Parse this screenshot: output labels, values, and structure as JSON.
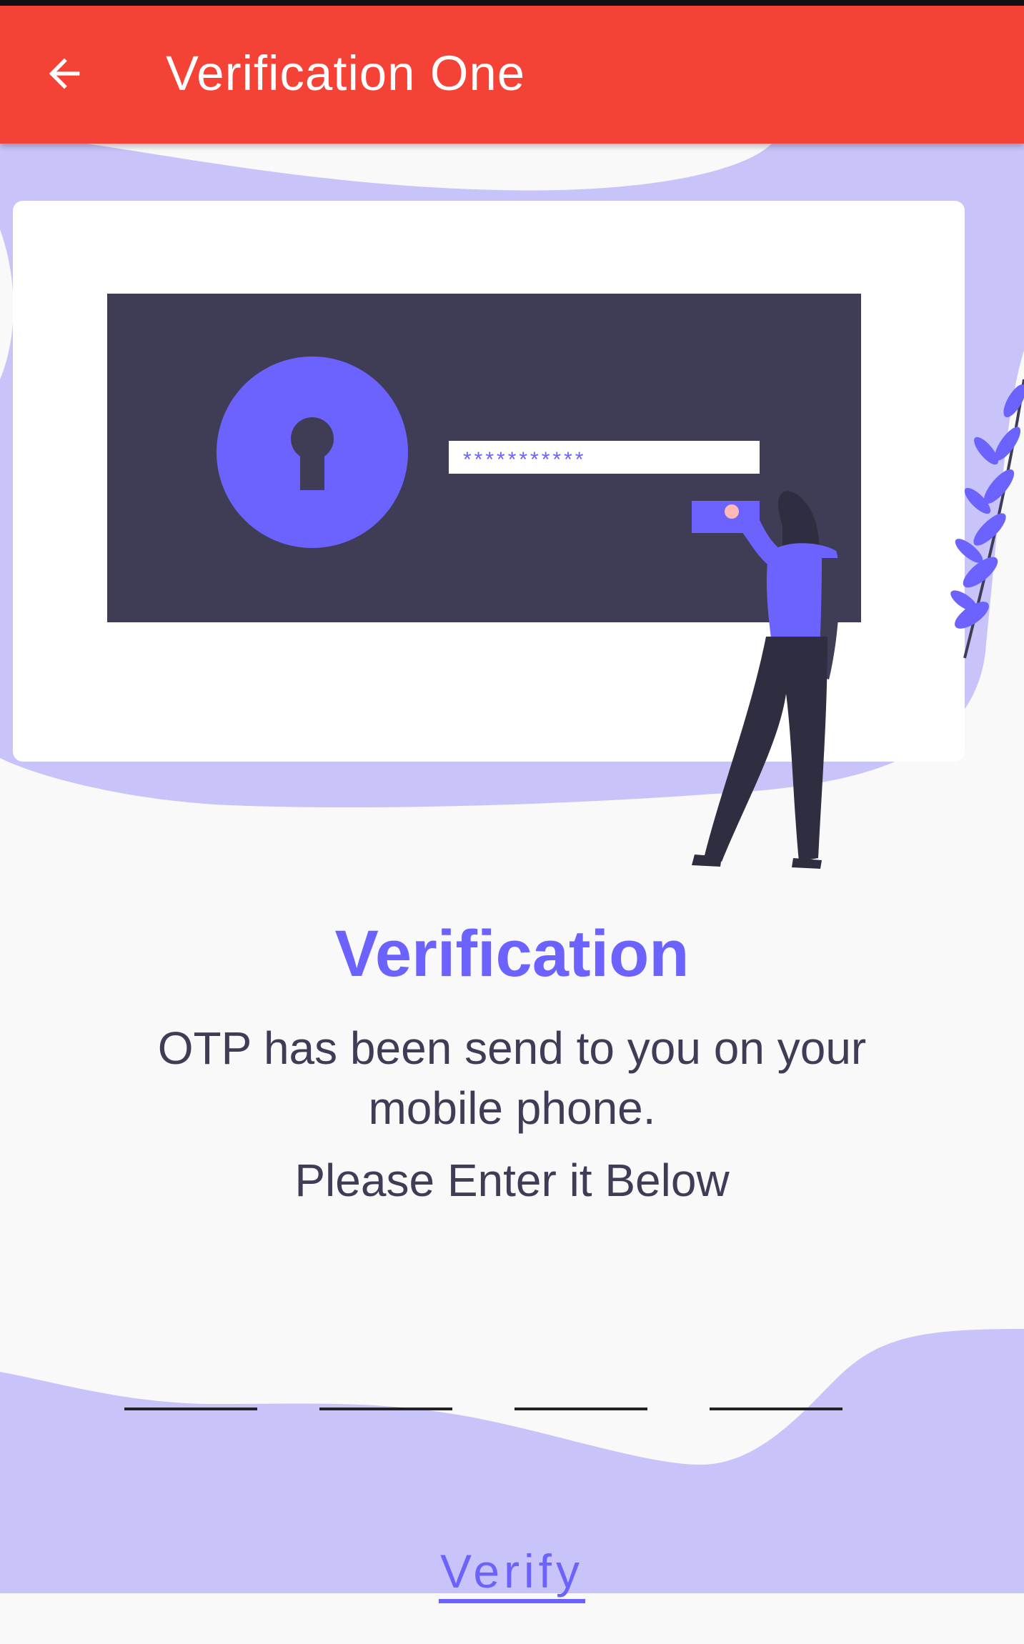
{
  "appbar": {
    "title": "Verification One",
    "back_icon": "arrow-left-icon",
    "color": "#f44336"
  },
  "illustration": {
    "password_mask": "***********",
    "accent": "#6c63ff",
    "panel_dark": "#3f3d56",
    "blob_color": "#c8c4f9"
  },
  "content": {
    "heading": "Verification",
    "description_line1": "OTP has been send to you on your",
    "description_line2": "mobile phone.",
    "instruction": "Please Enter it Below"
  },
  "otp": {
    "fields": [
      "",
      "",
      "",
      ""
    ]
  },
  "actions": {
    "verify_label": "Verify"
  }
}
